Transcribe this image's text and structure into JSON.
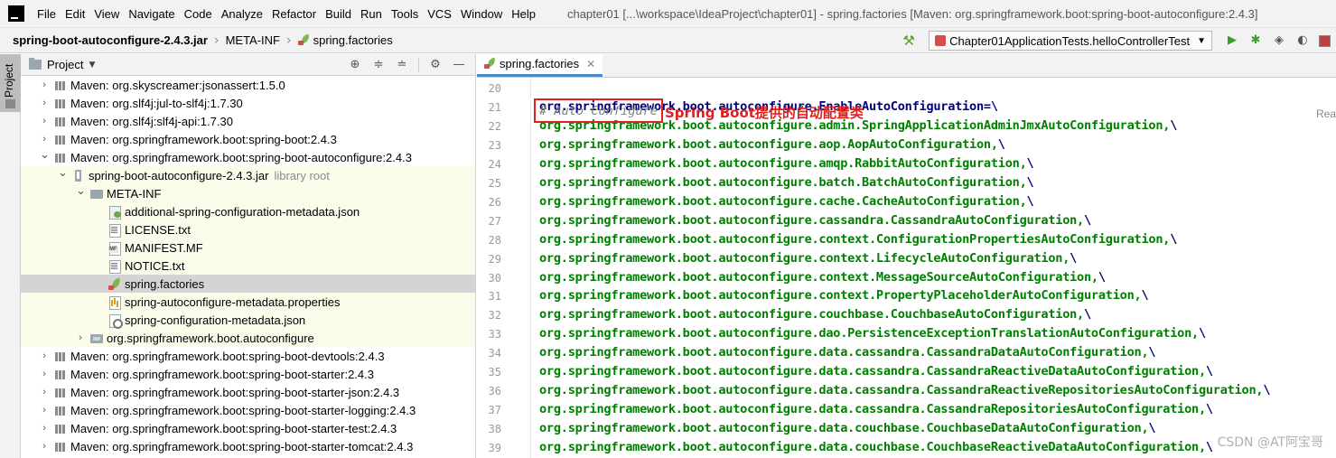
{
  "menu": {
    "items": [
      "File",
      "Edit",
      "View",
      "Navigate",
      "Code",
      "Analyze",
      "Refactor",
      "Build",
      "Run",
      "Tools",
      "VCS",
      "Window",
      "Help"
    ],
    "window_title": "chapter01 [...\\workspace\\IdeaProject\\chapter01] - spring.factories [Maven: org.springframework.boot:spring-boot-autoconfigure:2.4.3]"
  },
  "nav": {
    "breadcrumbs": [
      "spring-boot-autoconfigure-2.4.3.jar",
      "META-INF",
      "spring.factories"
    ],
    "run_config": "Chapter01ApplicationTests.helloControllerTest"
  },
  "tool_strip": {
    "label": "Project"
  },
  "project_panel": {
    "title": "Project",
    "tree": [
      {
        "label": "Maven: org.skyscreamer:jsonassert:1.5.0",
        "depth": 0,
        "arrow": "collapsed",
        "icon": "library-icon"
      },
      {
        "label": "Maven: org.slf4j:jul-to-slf4j:1.7.30",
        "depth": 0,
        "arrow": "collapsed",
        "icon": "library-icon"
      },
      {
        "label": "Maven: org.slf4j:slf4j-api:1.7.30",
        "depth": 0,
        "arrow": "collapsed",
        "icon": "library-icon"
      },
      {
        "label": "Maven: org.springframework.boot:spring-boot:2.4.3",
        "depth": 0,
        "arrow": "collapsed",
        "icon": "library-icon"
      },
      {
        "label": "Maven: org.springframework.boot:spring-boot-autoconfigure:2.4.3",
        "depth": 0,
        "arrow": "expanded",
        "icon": "library-icon"
      },
      {
        "label": "spring-boot-autoconfigure-2.4.3.jar",
        "suffix": "library root",
        "depth": 1,
        "arrow": "expanded",
        "icon": "jar-icon",
        "lib": true
      },
      {
        "label": "META-INF",
        "depth": 2,
        "arrow": "expanded",
        "icon": "folder-icon",
        "lib": true
      },
      {
        "label": "additional-spring-configuration-metadata.json",
        "depth": 3,
        "arrow": "none",
        "icon": "json-file-icon",
        "lib": true
      },
      {
        "label": "LICENSE.txt",
        "depth": 3,
        "arrow": "none",
        "icon": "text-file-icon",
        "lib": true
      },
      {
        "label": "MANIFEST.MF",
        "depth": 3,
        "arrow": "none",
        "icon": "manifest-file-icon",
        "lib": true
      },
      {
        "label": "NOTICE.txt",
        "depth": 3,
        "arrow": "none",
        "icon": "text-file-icon",
        "lib": true
      },
      {
        "label": "spring.factories",
        "depth": 3,
        "arrow": "none",
        "icon": "spring-factories-icon",
        "lib": true,
        "selected": true
      },
      {
        "label": "spring-autoconfigure-metadata.properties",
        "depth": 3,
        "arrow": "none",
        "icon": "properties-file-icon",
        "lib": true
      },
      {
        "label": "spring-configuration-metadata.json",
        "depth": 3,
        "arrow": "none",
        "icon": "config-json-icon",
        "lib": true
      },
      {
        "label": "org.springframework.boot.autoconfigure",
        "depth": 2,
        "arrow": "collapsed",
        "icon": "package-icon",
        "lib": true
      },
      {
        "label": "Maven: org.springframework.boot:spring-boot-devtools:2.4.3",
        "depth": 0,
        "arrow": "collapsed",
        "icon": "library-icon"
      },
      {
        "label": "Maven: org.springframework.boot:spring-boot-starter:2.4.3",
        "depth": 0,
        "arrow": "collapsed",
        "icon": "library-icon"
      },
      {
        "label": "Maven: org.springframework.boot:spring-boot-starter-json:2.4.3",
        "depth": 0,
        "arrow": "collapsed",
        "icon": "library-icon"
      },
      {
        "label": "Maven: org.springframework.boot:spring-boot-starter-logging:2.4.3",
        "depth": 0,
        "arrow": "collapsed",
        "icon": "library-icon"
      },
      {
        "label": "Maven: org.springframework.boot:spring-boot-starter-test:2.4.3",
        "depth": 0,
        "arrow": "collapsed",
        "icon": "library-icon"
      },
      {
        "label": "Maven: org.springframework.boot:spring-boot-starter-tomcat:2.4.3",
        "depth": 0,
        "arrow": "collapsed",
        "icon": "library-icon"
      }
    ]
  },
  "editor": {
    "tab_label": "spring.factories",
    "reader_hint": "Rea",
    "annotation": "Spring Boot提供的自动配置类",
    "comment_text": "# Auto Configure",
    "lines": [
      {
        "num": "20",
        "comment": "# Auto Configure"
      },
      {
        "num": "21",
        "key": "org.springframework.boot.autoconfigure.EnableAutoConfiguration",
        "sep": "=\\"
      },
      {
        "num": "22",
        "val": "org.springframework.boot.autoconfigure.admin.SpringApplicationAdminJmxAutoConfiguration,",
        "bs": "\\"
      },
      {
        "num": "23",
        "val": "org.springframework.boot.autoconfigure.aop.AopAutoConfiguration,",
        "bs": "\\"
      },
      {
        "num": "24",
        "val": "org.springframework.boot.autoconfigure.amqp.RabbitAutoConfiguration,",
        "bs": "\\"
      },
      {
        "num": "25",
        "val": "org.springframework.boot.autoconfigure.batch.BatchAutoConfiguration,",
        "bs": "\\"
      },
      {
        "num": "26",
        "val": "org.springframework.boot.autoconfigure.cache.CacheAutoConfiguration,",
        "bs": "\\"
      },
      {
        "num": "27",
        "val": "org.springframework.boot.autoconfigure.cassandra.CassandraAutoConfiguration,",
        "bs": "\\"
      },
      {
        "num": "28",
        "val": "org.springframework.boot.autoconfigure.context.ConfigurationPropertiesAutoConfiguration,",
        "bs": "\\"
      },
      {
        "num": "29",
        "val": "org.springframework.boot.autoconfigure.context.LifecycleAutoConfiguration,",
        "bs": "\\"
      },
      {
        "num": "30",
        "val": "org.springframework.boot.autoconfigure.context.MessageSourceAutoConfiguration,",
        "bs": "\\"
      },
      {
        "num": "31",
        "val": "org.springframework.boot.autoconfigure.context.PropertyPlaceholderAutoConfiguration,",
        "bs": "\\"
      },
      {
        "num": "32",
        "val": "org.springframework.boot.autoconfigure.couchbase.CouchbaseAutoConfiguration,",
        "bs": "\\"
      },
      {
        "num": "33",
        "val": "org.springframework.boot.autoconfigure.dao.PersistenceExceptionTranslationAutoConfiguration,",
        "bs": "\\"
      },
      {
        "num": "34",
        "val": "org.springframework.boot.autoconfigure.data.cassandra.CassandraDataAutoConfiguration,",
        "bs": "\\"
      },
      {
        "num": "35",
        "val": "org.springframework.boot.autoconfigure.data.cassandra.CassandraReactiveDataAutoConfiguration,",
        "bs": "\\"
      },
      {
        "num": "36",
        "val": "org.springframework.boot.autoconfigure.data.cassandra.CassandraReactiveRepositoriesAutoConfiguration,",
        "bs": "\\"
      },
      {
        "num": "37",
        "val": "org.springframework.boot.autoconfigure.data.cassandra.CassandraRepositoriesAutoConfiguration,",
        "bs": "\\"
      },
      {
        "num": "38",
        "val": "org.springframework.boot.autoconfigure.data.couchbase.CouchbaseDataAutoConfiguration,",
        "bs": "\\"
      },
      {
        "num": "39",
        "val": "org.springframework.boot.autoconfigure.data.couchbase.CouchbaseReactiveDataAutoConfiguration,",
        "bs": "\\"
      }
    ]
  },
  "watermark": "CSDN @AT阿宝哥",
  "colors": {
    "annotation_red": "#e02020",
    "key_navy": "#000080",
    "value_green": "#008000",
    "selection_gray": "#d4d4d4",
    "library_bg": "#fbfbea",
    "tab_underline": "#4a88c7"
  }
}
